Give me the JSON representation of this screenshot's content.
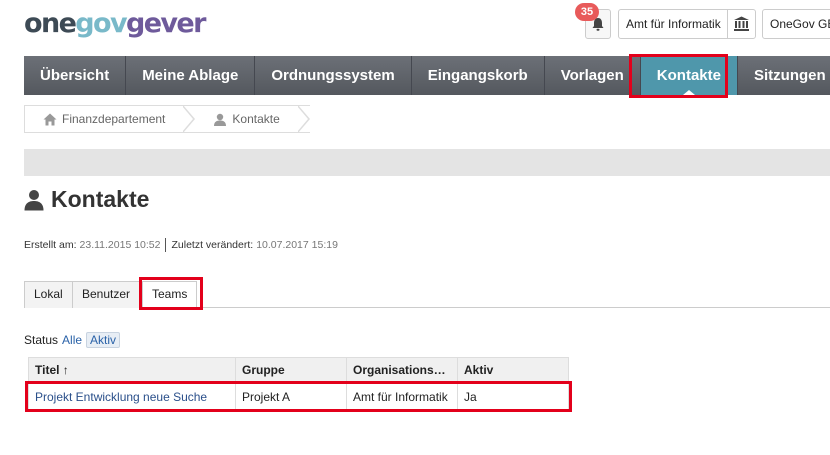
{
  "header": {
    "logo": {
      "part1": "one",
      "part2": "gov",
      "part3": "gever"
    },
    "notifications_count": "35",
    "org_unit": "Amt für Informatik",
    "admin_unit": "OneGov GEVER"
  },
  "nav": {
    "items": [
      {
        "label": "Übersicht"
      },
      {
        "label": "Meine Ablage"
      },
      {
        "label": "Ordnungssystem"
      },
      {
        "label": "Eingangskorb"
      },
      {
        "label": "Vorlagen"
      },
      {
        "label": "Kontakte",
        "active": true
      },
      {
        "label": "Sitzungen"
      }
    ]
  },
  "breadcrumb": [
    {
      "label": "Finanzdepartement",
      "icon": "home-icon"
    },
    {
      "label": "Kontakte",
      "icon": "user-icon"
    }
  ],
  "page": {
    "title": "Kontakte",
    "created_label": "Erstellt am:",
    "created_value": "23.11.2015 10:52",
    "modified_label": "Zuletzt verändert:",
    "modified_value": "10.07.2017 15:19"
  },
  "tabs": [
    {
      "label": "Lokal"
    },
    {
      "label": "Benutzer"
    },
    {
      "label": "Teams",
      "active": true
    }
  ],
  "filter": {
    "label": "Status",
    "options": [
      "Alle",
      "Aktiv"
    ],
    "selected": "Aktiv"
  },
  "table": {
    "columns": [
      "Titel ↑",
      "Gruppe",
      "Organisations…",
      "Aktiv"
    ],
    "rows": [
      [
        "Projekt Entwicklung neue Suche",
        "Projekt A",
        "Amt für Informatik",
        "Ja"
      ]
    ]
  },
  "colors": {
    "nav_bg": "#5f6369",
    "nav_active": "#4f97ab",
    "highlight": "#e3001b",
    "badge": "#e85a5a",
    "link": "#2a4f8a"
  }
}
